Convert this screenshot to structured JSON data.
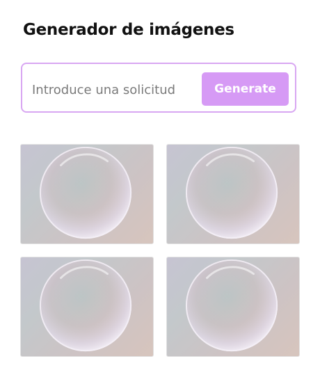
{
  "header": {
    "title": "Generador de imágenes"
  },
  "prompt": {
    "placeholder": "Introduce una solicitud",
    "value": "",
    "generate_label": "Generate"
  },
  "colors": {
    "accent": "#d69af5",
    "accent_border": "#d8a6f2",
    "title_text": "#111111"
  },
  "gallery": {
    "images": [
      {
        "content": "soap-bubble"
      },
      {
        "content": "soap-bubble"
      },
      {
        "content": "soap-bubble"
      },
      {
        "content": "soap-bubble"
      }
    ]
  }
}
